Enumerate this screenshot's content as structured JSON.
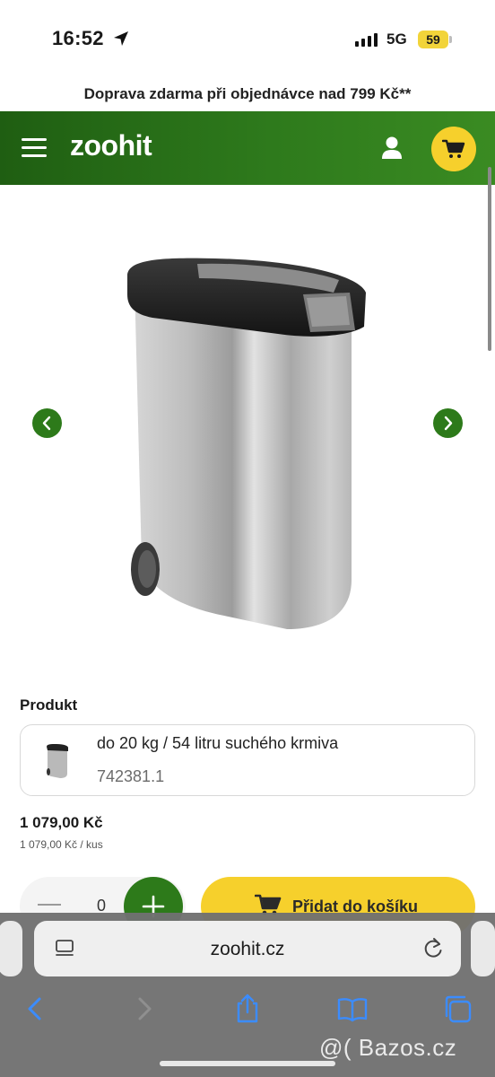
{
  "status_bar": {
    "time": "16:52",
    "network": "5G",
    "battery": "59"
  },
  "promo": {
    "text": "Doprava zdarma při objednávce nad 799 Kč**"
  },
  "header": {
    "logo": "zoohit",
    "accent_color": "#2d7a1a",
    "cart_color": "#f6d02c"
  },
  "gallery": {
    "prev_icon": "chevron-left-icon",
    "next_icon": "chevron-right-icon"
  },
  "product": {
    "section_label": "Produkt",
    "variant_name": "do 20 kg / 54 litru suchého krmiva",
    "variant_code": "742381.1",
    "price": "1 079,00 Kč",
    "unit_price": "1 079,00 Kč / kus",
    "quantity": "0",
    "add_to_cart_label": "Přidat do košíku"
  },
  "browser": {
    "url": "zoohit.cz"
  },
  "watermark": {
    "text": "@( Bazos.cz"
  }
}
